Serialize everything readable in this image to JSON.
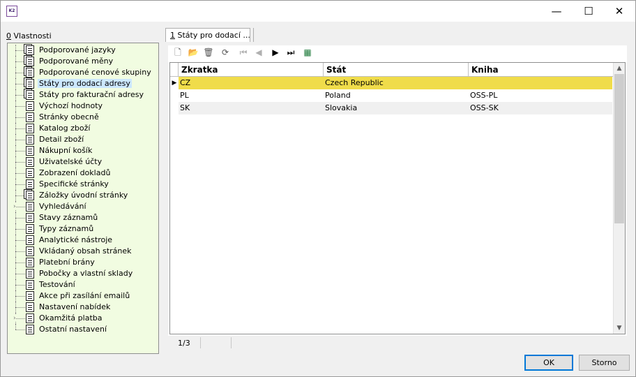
{
  "window": {
    "app_icon_text": "K2",
    "minimize": "—",
    "maximize": "☐",
    "close": "✕"
  },
  "left": {
    "label_mnemonic": "0",
    "label_rest": " Vlastnosti",
    "tree": [
      {
        "label": "Podporované jazyky",
        "multi": true,
        "expandable": false,
        "selected": false
      },
      {
        "label": "Podporované měny",
        "multi": true,
        "expandable": false,
        "selected": false
      },
      {
        "label": "Podporované cenové skupiny",
        "multi": true,
        "expandable": false,
        "selected": false
      },
      {
        "label": "Státy pro dodací adresy",
        "multi": true,
        "expandable": false,
        "selected": true
      },
      {
        "label": "Státy pro fakturační adresy",
        "multi": true,
        "expandable": false,
        "selected": false
      },
      {
        "label": "Výchozí hodnoty",
        "multi": false,
        "expandable": false,
        "selected": false
      },
      {
        "label": "Stránky obecně",
        "multi": false,
        "expandable": false,
        "selected": false
      },
      {
        "label": "Katalog zboží",
        "multi": false,
        "expandable": false,
        "selected": false
      },
      {
        "label": "Detail zboží",
        "multi": false,
        "expandable": false,
        "selected": false
      },
      {
        "label": "Nákupní košík",
        "multi": false,
        "expandable": false,
        "selected": false
      },
      {
        "label": "Uživatelské účty",
        "multi": false,
        "expandable": false,
        "selected": false
      },
      {
        "label": "Zobrazení dokladů",
        "multi": false,
        "expandable": false,
        "selected": false
      },
      {
        "label": "Specifické stránky",
        "multi": false,
        "expandable": false,
        "selected": false
      },
      {
        "label": "Záložky úvodní stránky",
        "multi": true,
        "expandable": false,
        "selected": false
      },
      {
        "label": "Vyhledávání",
        "multi": false,
        "expandable": true,
        "selected": false
      },
      {
        "label": "Stavy záznamů",
        "multi": false,
        "expandable": false,
        "selected": false
      },
      {
        "label": "Typy záznamů",
        "multi": false,
        "expandable": false,
        "selected": false
      },
      {
        "label": "Analytické nástroje",
        "multi": false,
        "expandable": false,
        "selected": false
      },
      {
        "label": "Vkládaný obsah stránek",
        "multi": false,
        "expandable": false,
        "selected": false
      },
      {
        "label": "Platební brány",
        "multi": false,
        "expandable": false,
        "selected": false
      },
      {
        "label": "Pobočky a vlastní sklady",
        "multi": false,
        "expandable": false,
        "selected": false
      },
      {
        "label": "Testování",
        "multi": false,
        "expandable": false,
        "selected": false
      },
      {
        "label": "Akce při zasílání emailů",
        "multi": false,
        "expandable": false,
        "selected": false
      },
      {
        "label": "Nastavení nabídek",
        "multi": false,
        "expandable": false,
        "selected": false
      },
      {
        "label": "Okamžitá platba",
        "multi": false,
        "expandable": true,
        "selected": false
      },
      {
        "label": "Ostatní nastavení",
        "multi": false,
        "expandable": false,
        "selected": false
      }
    ]
  },
  "tab": {
    "mnemonic": "1",
    "rest": " Státy pro dodací ..."
  },
  "grid": {
    "columns": [
      "Zkratka",
      "Stát",
      "Kniha"
    ],
    "rows": [
      {
        "zkratka": "CZ",
        "stat": "Czech Republic",
        "kniha": "",
        "selected": true
      },
      {
        "zkratka": "PL",
        "stat": "Poland",
        "kniha": "OSS-PL",
        "selected": false
      },
      {
        "zkratka": "SK",
        "stat": "Slovakia",
        "kniha": "OSS-SK",
        "selected": false
      }
    ],
    "selected_color": "#f0dc4a",
    "alt_row_color": "#f0f0f0",
    "record_indicator": "▶"
  },
  "status": {
    "count": "1/3"
  },
  "buttons": {
    "ok": "OK",
    "cancel": "Storno"
  }
}
